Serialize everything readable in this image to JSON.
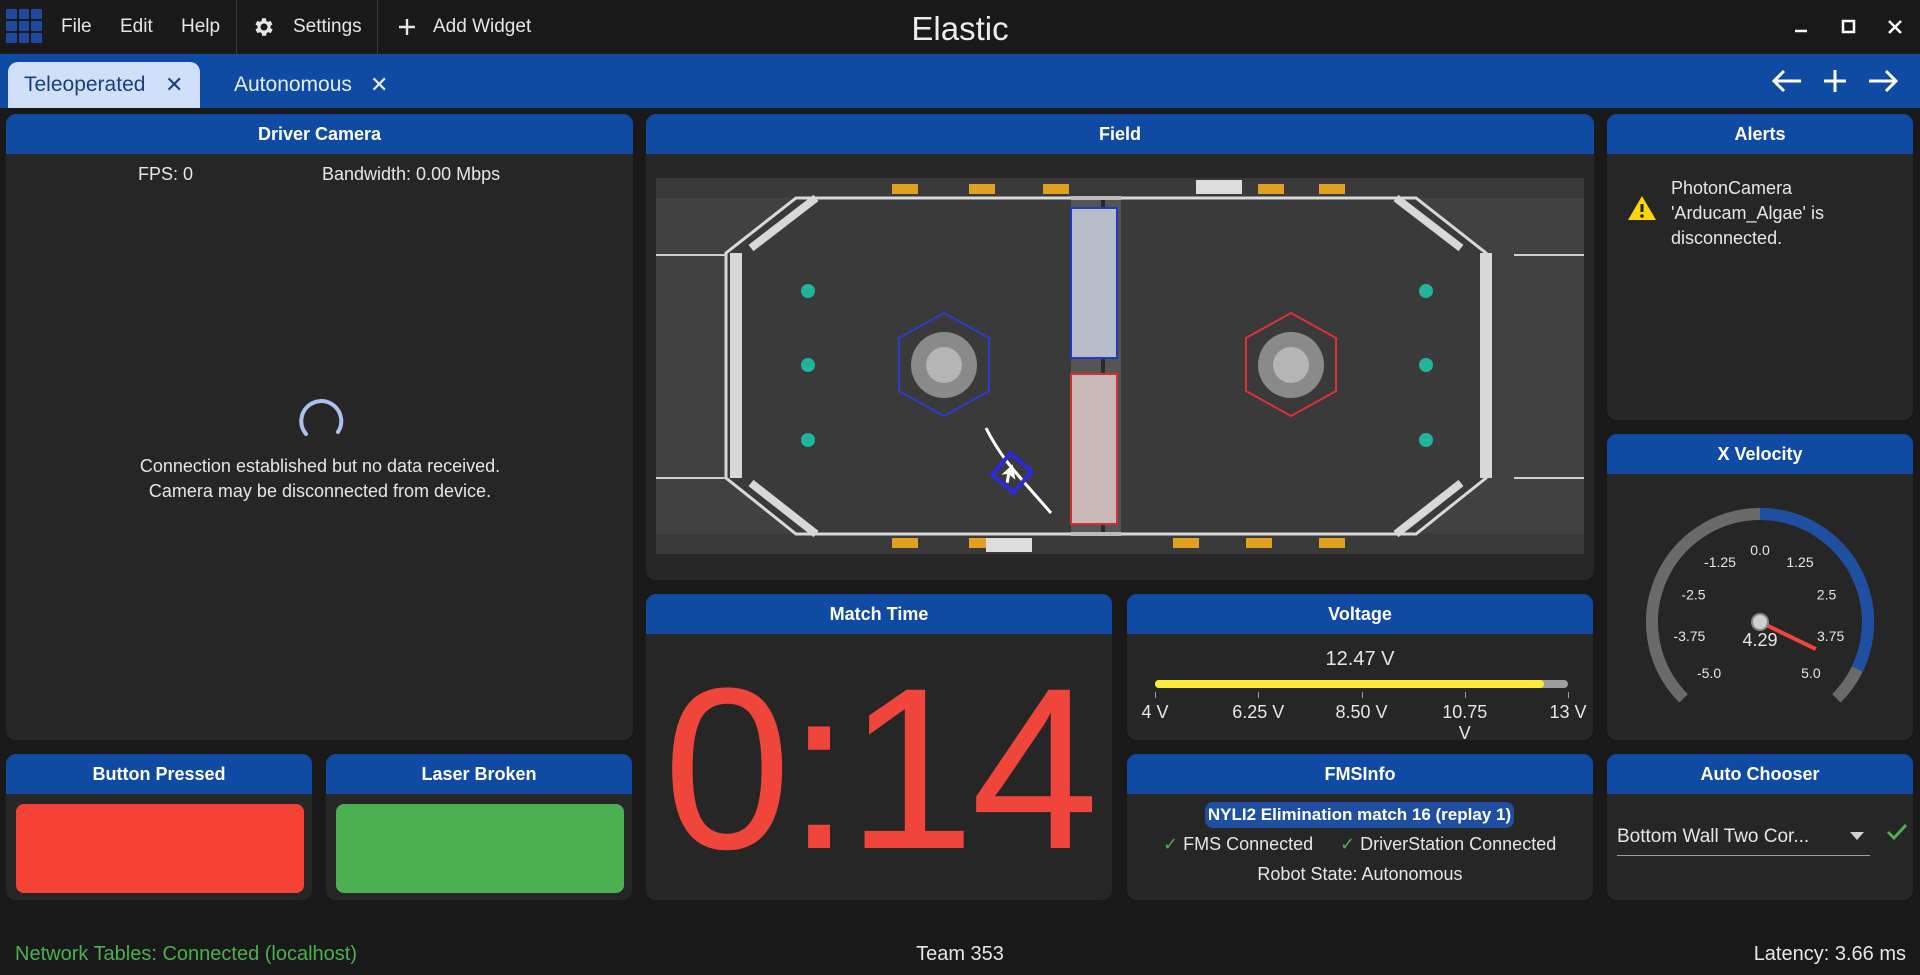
{
  "window": {
    "title": "Elastic"
  },
  "menu": {
    "file": "File",
    "edit": "Edit",
    "help": "Help",
    "settings": "Settings",
    "add_widget": "Add Widget"
  },
  "tabs": [
    {
      "label": "Teleoperated",
      "active": true
    },
    {
      "label": "Autonomous",
      "active": false
    }
  ],
  "widgets": {
    "driver_camera": {
      "title": "Driver Camera",
      "fps": "FPS: 0",
      "bandwidth": "Bandwidth: 0.00 Mbps",
      "message_line1": "Connection established but no data received.",
      "message_line2": "Camera may be disconnected from device."
    },
    "field": {
      "title": "Field"
    },
    "alerts": {
      "title": "Alerts",
      "items": [
        {
          "level": "warning",
          "line1": "PhotonCamera",
          "line2": "'Arducam_Algae' is",
          "line3": "disconnected."
        }
      ]
    },
    "x_velocity": {
      "title": "X Velocity",
      "value": "4.29",
      "value_number": 4.29,
      "min": -5.0,
      "max": 5.0,
      "tick_labels": [
        "-5.0",
        "-3.75",
        "-2.5",
        "-1.25",
        "0.0",
        "1.25",
        "2.5",
        "3.75",
        "5.0"
      ]
    },
    "match_time": {
      "title": "Match Time",
      "value": "0:14"
    },
    "voltage": {
      "title": "Voltage",
      "value": "12.47 V",
      "value_number": 12.47,
      "min": 4,
      "max": 13,
      "tick_labels": [
        "4 V",
        "6.25 V",
        "8.50 V",
        "10.75 V",
        "13 V"
      ]
    },
    "button_pressed": {
      "title": "Button Pressed",
      "value": false,
      "color": "#f44336"
    },
    "laser_broken": {
      "title": "Laser Broken",
      "value": true,
      "color": "#4caf50"
    },
    "fms_info": {
      "title": "FMSInfo",
      "event_match": "NYLI2 Elimination match 16 (replay 1)",
      "fms_connected": "FMS Connected",
      "ds_connected": "DriverStation Connected",
      "robot_state": "Robot State: Autonomous"
    },
    "auto_chooser": {
      "title": "Auto Chooser",
      "selected": "Bottom Wall Two Cor..."
    }
  },
  "status_bar": {
    "network": "Network Tables: Connected (localhost)",
    "team": "Team 353",
    "latency": "Latency:  3.66 ms"
  },
  "colors": {
    "accent": "#0f4aa3",
    "background": "#191919",
    "widget": "#262626",
    "danger": "#f0453a",
    "success": "#4caf50",
    "voltage_fill": "#ffeb3b"
  }
}
